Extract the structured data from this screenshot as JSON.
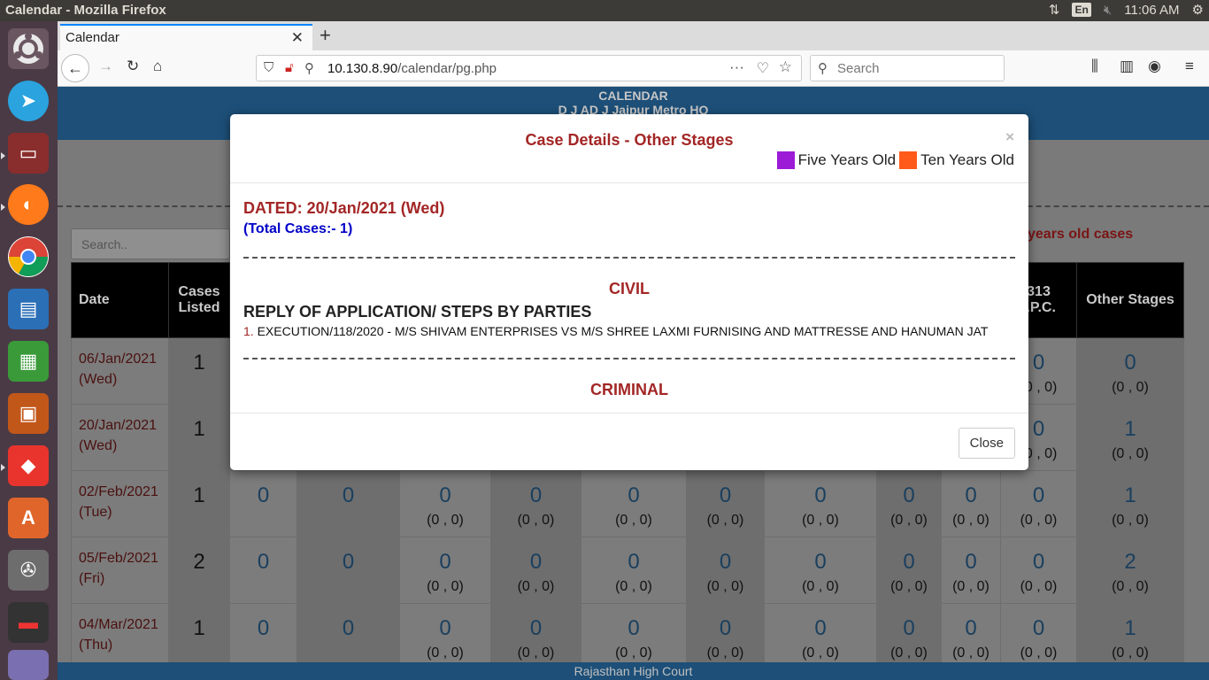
{
  "os": {
    "window_title": "Calendar - Mozilla Firefox",
    "keyboard_layout": "En",
    "clock": "11:06 AM"
  },
  "browser": {
    "tab_title": "Calendar",
    "url_host": "10.130.8.90",
    "url_path": "/calendar/pg.php",
    "search_placeholder": "Search"
  },
  "page": {
    "header_title": "CALENDAR",
    "header_sub": "D J AD J Jaipur Metro HQ",
    "search_placeholder": "Search..",
    "legend_partial": "years old cases",
    "footer": "Rajasthan High Court",
    "columns": {
      "date": "Date",
      "cases_listed": "Cases Listed",
      "col313a": "313",
      "col313b": "r.P.C.",
      "other_stages": "Other Stages"
    },
    "rows": [
      {
        "date": "06/Jan/2021",
        "day": "(Wed)",
        "listed": "1",
        "c313": "0",
        "c313sub": "(0 , 0)",
        "other": "0",
        "othersub": "(0 , 0)"
      },
      {
        "date": "20/Jan/2021",
        "day": "(Wed)",
        "listed": "1",
        "c313": "0",
        "c313sub": "(0 , 0)",
        "other": "1",
        "othersub": "(0 , 0)"
      },
      {
        "date": "02/Feb/2021",
        "day": "(Tue)",
        "listed": "1",
        "a": "0",
        "b": "0",
        "c": "0",
        "csub": "(0 , 0)",
        "d": "0",
        "dsub": "(0 , 0)",
        "e": "0",
        "esub": "(0 , 0)",
        "f": "0",
        "fsub": "(0 , 0)",
        "g": "0",
        "gsub": "(0 , 0)",
        "h": "0",
        "hsub": "(0 , 0)",
        "i": "0",
        "isub": "(0 , 0)",
        "c313": "0",
        "c313sub": "(0 , 0)",
        "other": "1",
        "othersub": "(0 , 0)"
      },
      {
        "date": "05/Feb/2021",
        "day": "(Fri)",
        "listed": "2",
        "a": "0",
        "b": "0",
        "c": "0",
        "csub": "(0 , 0)",
        "d": "0",
        "dsub": "(0 , 0)",
        "e": "0",
        "esub": "(0 , 0)",
        "f": "0",
        "fsub": "(0 , 0)",
        "g": "0",
        "gsub": "(0 , 0)",
        "h": "0",
        "hsub": "(0 , 0)",
        "i": "0",
        "isub": "(0 , 0)",
        "c313": "0",
        "c313sub": "(0 , 0)",
        "other": "2",
        "othersub": "(0 , 0)"
      },
      {
        "date": "04/Mar/2021",
        "day": "(Thu)",
        "listed": "1",
        "a": "0",
        "b": "0",
        "c": "0",
        "csub": "(0 , 0)",
        "d": "0",
        "dsub": "(0 , 0)",
        "e": "0",
        "esub": "(0 , 0)",
        "f": "0",
        "fsub": "(0 , 0)",
        "g": "0",
        "gsub": "(0 , 0)",
        "h": "0",
        "hsub": "(0 , 0)",
        "i": "0",
        "isub": "(0 , 0)",
        "c313": "0",
        "c313sub": "(0 , 0)",
        "other": "1",
        "othersub": "(0 , 0)"
      }
    ]
  },
  "modal": {
    "title": "Case Details - Other Stages",
    "close_x": "×",
    "legend": [
      {
        "label": "Five Years Old",
        "color": "#9b1bd6"
      },
      {
        "label": "Ten Years Old",
        "color": "#ff5a1a"
      }
    ],
    "dated": "DATED: 20/Jan/2021 (Wed)",
    "total": "(Total Cases:- 1)",
    "civil_heading": "CIVIL",
    "stage_heading": "REPLY OF APPLICATION/ STEPS BY PARTIES",
    "case_number": "1.",
    "case_text": "EXECUTION/118/2020 - M/S SHIVAM ENTERPRISES VS M/S SHREE LAXMI FURNISING AND MATTRESSE AND HANUMAN JAT",
    "criminal_heading": "CRIMINAL",
    "close_button": "Close"
  }
}
